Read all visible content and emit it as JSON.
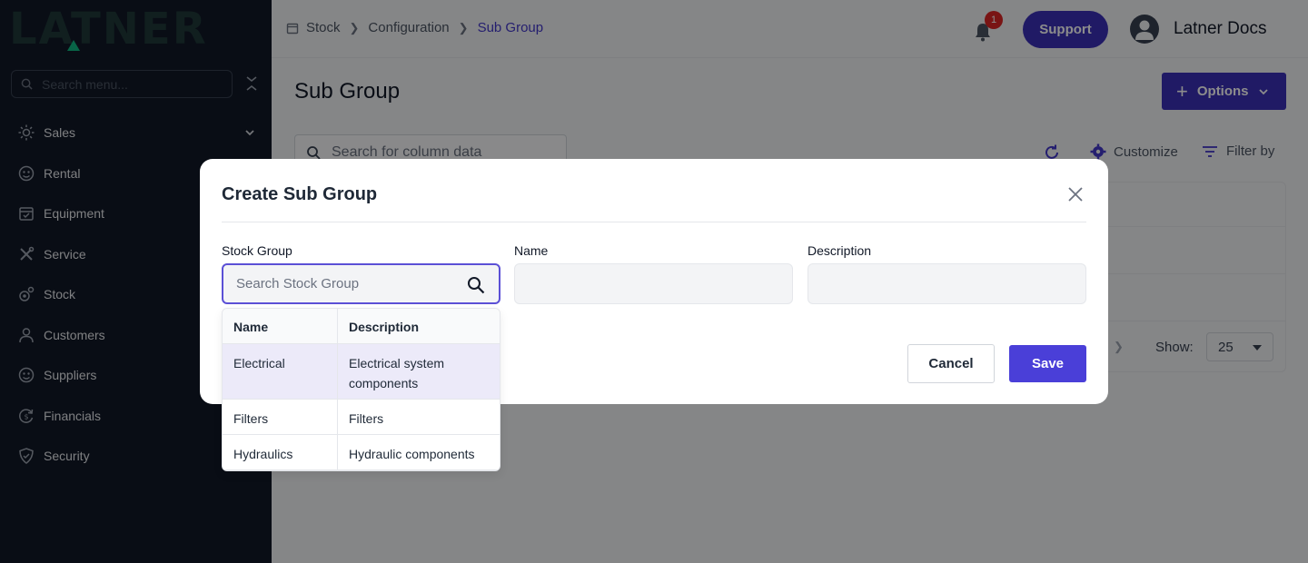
{
  "sidebar": {
    "logo_text": "LATNER",
    "search_placeholder": "Search menu...",
    "items": [
      {
        "label": "Sales",
        "icon": "sales-icon"
      },
      {
        "label": "Rental",
        "icon": "rental-icon"
      },
      {
        "label": "Equipment",
        "icon": "equipment-icon"
      },
      {
        "label": "Service",
        "icon": "service-icon"
      },
      {
        "label": "Stock",
        "icon": "stock-icon"
      },
      {
        "label": "Customers",
        "icon": "customers-icon"
      },
      {
        "label": "Suppliers",
        "icon": "suppliers-icon"
      },
      {
        "label": "Financials",
        "icon": "financials-icon"
      },
      {
        "label": "Security",
        "icon": "security-icon"
      }
    ]
  },
  "header": {
    "breadcrumb": [
      "Stock",
      "Configuration",
      "Sub Group"
    ],
    "notification_count": "1",
    "support_label": "Support",
    "user_name": "Latner Docs"
  },
  "main": {
    "page_title": "Sub Group",
    "options_label": "Options",
    "column_search_placeholder": "Search for column data",
    "customize_label": "Customize",
    "filter_label": "Filter by",
    "show_label": "Show:",
    "show_value": "25"
  },
  "modal": {
    "title": "Create Sub Group",
    "fields": {
      "stock_group_label": "Stock Group",
      "stock_group_placeholder": "Search Stock Group",
      "name_label": "Name",
      "description_label": "Description"
    },
    "cancel_label": "Cancel",
    "save_label": "Save",
    "dropdown": {
      "headers": [
        "Name",
        "Description"
      ],
      "rows": [
        {
          "name": "Electrical",
          "description": "Electrical system components"
        },
        {
          "name": "Filters",
          "description": "Filters"
        },
        {
          "name": "Hydraulics",
          "description": "Hydraulic components"
        }
      ]
    }
  },
  "colors": {
    "accent": "#3b30b8",
    "sidebar_bg": "#111827",
    "badge": "#dc2626"
  }
}
